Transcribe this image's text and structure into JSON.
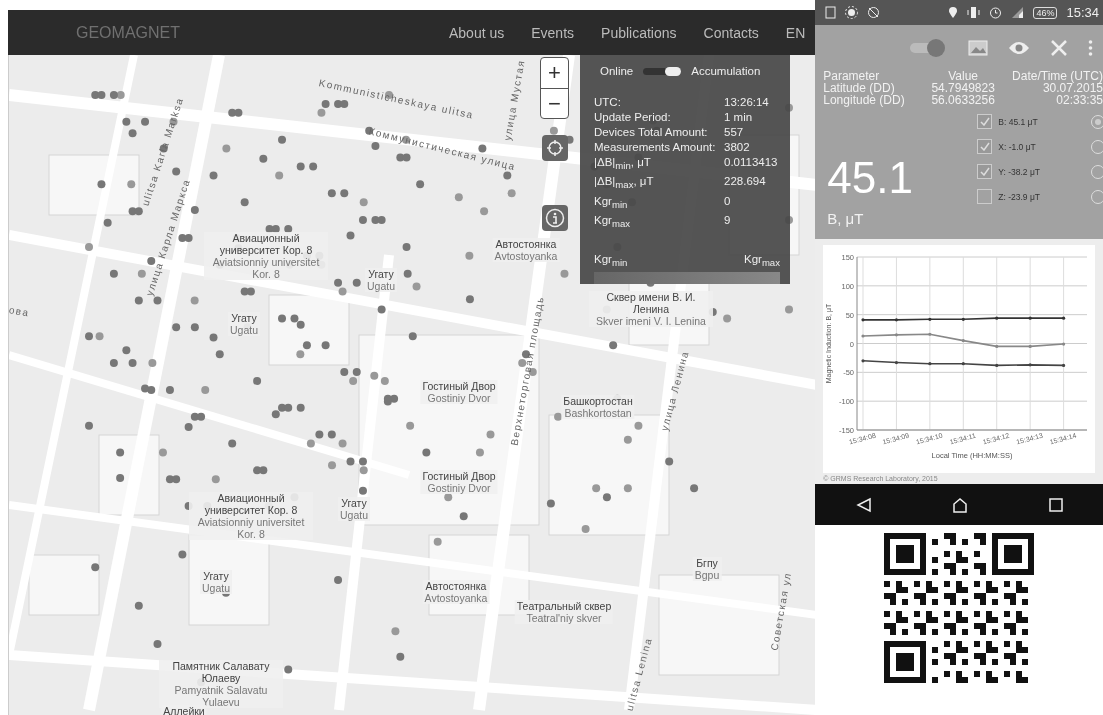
{
  "web": {
    "brand": "GEOMAGNET",
    "nav": [
      {
        "label": "About us"
      },
      {
        "label": "Events"
      },
      {
        "label": "Publications"
      },
      {
        "label": "Contacts"
      },
      {
        "label": "EN"
      }
    ],
    "map": {
      "zoom_in": "+",
      "zoom_out": "−",
      "labels": [
        {
          "ru": "Авиационный университет Кор. 8",
          "lat": "Aviatsionniy universitet Kor. 8"
        },
        {
          "ru": "Угату",
          "lat": "Ugatu"
        },
        {
          "ru": "Угату",
          "lat": "Ugatu"
        },
        {
          "ru": "Автостоянка",
          "lat": "Avtostoyanka"
        },
        {
          "ru": "Сквер имени В. И. Ленина",
          "lat": "Skver imeni V. I. Lenina"
        },
        {
          "ru": "Гостиный Двор",
          "lat": "Gostiniy Dvor"
        },
        {
          "ru": "Башкортостан",
          "lat": "Bashkortostan"
        },
        {
          "ru": "Гостиный Двор",
          "lat": "Gostiniy Dvor"
        },
        {
          "ru": "Авиационный университет Кор. 8",
          "lat": "Aviatsionniy universitet Kor. 8"
        },
        {
          "ru": "Угату",
          "lat": "Ugatu"
        },
        {
          "ru": "Угату",
          "lat": "Ugatu"
        },
        {
          "ru": "Автостоянка",
          "lat": "Avtostoyanka"
        },
        {
          "ru": "Театральный сквер",
          "lat": "Teatral'niy skver"
        },
        {
          "ru": "Бгпу",
          "lat": "Bgpu"
        },
        {
          "ru": "Памятник Салавату Юлаеву",
          "lat": "Pamyatnik Salavatu Yulaevu"
        },
        {
          "ru": "Аллейки"
        }
      ],
      "streets": [
        "ulitsa Karla Marksa",
        "улица Карла Маркса",
        "Коммунистическая улица",
        "Kommunisticheskaya ulitsa",
        "Верхнеторговая площадь",
        "улица Ленина",
        "ulitsa Lenina",
        "Советская ул",
        "ова",
        "улица Мустая"
      ]
    },
    "panel": {
      "mode_left": "Online",
      "mode_right": "Accumulation",
      "accumulation": {
        "on": true
      },
      "rows": [
        {
          "label": "UTC:",
          "value": "13:26:14"
        },
        {
          "label": "Update Period:",
          "value": "1 min"
        },
        {
          "label": "Devices Total Amount:",
          "value": "557"
        },
        {
          "label": "Measurements Amount:",
          "value": "3802"
        },
        {
          "label": "|ΔB|$_{min}$, μT",
          "value": "0.0113413"
        },
        {
          "label": "|ΔB|$_{max}$, μT",
          "value": "228.694"
        },
        {
          "label": "Kgr$_{min}$",
          "value": "0"
        },
        {
          "label": "Kgr$_{max}$",
          "value": "9"
        }
      ],
      "legend_min": "Kgr$_{min}$",
      "legend_max": "Kgr$_{max}$"
    }
  },
  "phone": {
    "battery": "46%",
    "time": "15:34",
    "live": {
      "on": true
    },
    "table": {
      "columns": [
        "Parameter",
        "Value",
        "Date/Time (UTC)"
      ],
      "rows": [
        {
          "parameter": "Latitude (DD)",
          "value": "54.7949823"
        },
        {
          "parameter": "Longitude (DD)",
          "value": "56.0633256"
        }
      ],
      "date": "30.07.2015",
      "time": "02:33:35"
    },
    "big_value": "45.1",
    "big_unit": "B, μT",
    "components": [
      {
        "label": "B: 45.1 μT",
        "checked": true,
        "selected": true
      },
      {
        "label": "X: -1.0 μT",
        "checked": true,
        "selected": false
      },
      {
        "label": "Y: -38.2 μT",
        "checked": true,
        "selected": false
      },
      {
        "label": "Z: -23.9 μT",
        "checked": false,
        "selected": false
      }
    ],
    "chart_data": {
      "type": "line",
      "grid": true,
      "xlabel": "Local Time (HH:MM:SS)",
      "ylabel": "Magnetic Induction: B, μT",
      "categories": [
        "15:34:08",
        "15:34:09",
        "15:34:10",
        "15:34:11",
        "15:34:12",
        "15:34:13",
        "15:34:14"
      ],
      "ylim": [
        -150,
        150
      ],
      "yticks": [
        -150,
        -100,
        -50,
        0,
        50,
        100,
        150
      ],
      "series": [
        {
          "color": "#333333",
          "values": [
            41,
            41,
            42,
            42,
            44,
            44,
            44
          ]
        },
        {
          "color": "#888888",
          "values": [
            13,
            15,
            16,
            5,
            -5,
            -5,
            -1
          ]
        },
        {
          "color": "#444444",
          "values": [
            -30,
            -33,
            -35,
            -35,
            -38,
            -37,
            -38
          ]
        }
      ]
    },
    "copyright": "© GRMS Research Laboratory, 2015"
  }
}
